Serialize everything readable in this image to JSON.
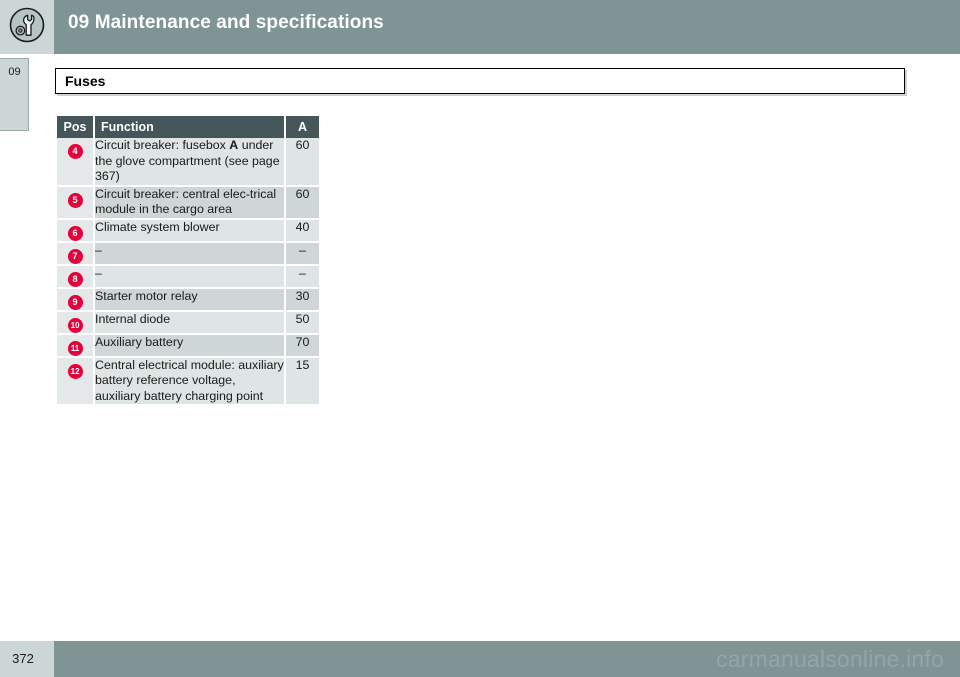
{
  "header": {
    "icon": "wrench-gear-icon",
    "title": "09 Maintenance and specifications",
    "bar_color": "#7f9495",
    "icon_cell_color": "#ccd6d6"
  },
  "chapter_tab": {
    "label": "09"
  },
  "section": {
    "title": "Fuses"
  },
  "table": {
    "columns": [
      "Pos",
      "Function",
      "A"
    ],
    "header_bg": "#44565a",
    "badge_color": "#e4003a",
    "rows": [
      {
        "pos": "4",
        "function_prefix": "Circuit breaker: fusebox ",
        "function_bold": "A",
        "function_suffix": " under the glove compartment (see page 367)",
        "amp": "60"
      },
      {
        "pos": "5",
        "function_prefix": "Circuit breaker: central elec-trical module in the cargo area",
        "function_bold": "",
        "function_suffix": "",
        "amp": "60"
      },
      {
        "pos": "6",
        "function_prefix": "Climate system blower",
        "function_bold": "",
        "function_suffix": "",
        "amp": "40"
      },
      {
        "pos": "7",
        "function_prefix": "–",
        "function_bold": "",
        "function_suffix": "",
        "amp": "–"
      },
      {
        "pos": "8",
        "function_prefix": "–",
        "function_bold": "",
        "function_suffix": "",
        "amp": "–"
      },
      {
        "pos": "9",
        "function_prefix": "Starter motor relay",
        "function_bold": "",
        "function_suffix": "",
        "amp": "30"
      },
      {
        "pos": "10",
        "function_prefix": "Internal diode",
        "function_bold": "",
        "function_suffix": "",
        "amp": "50"
      },
      {
        "pos": "11",
        "function_prefix": "Auxiliary battery",
        "function_bold": "",
        "function_suffix": "",
        "amp": "70"
      },
      {
        "pos": "12",
        "function_prefix": "Central electrical module: auxiliary battery reference voltage, auxiliary battery charging point",
        "function_bold": "",
        "function_suffix": "",
        "amp": "15"
      }
    ]
  },
  "footer": {
    "page_number": "372",
    "watermark": "carmanualsonline.info"
  }
}
